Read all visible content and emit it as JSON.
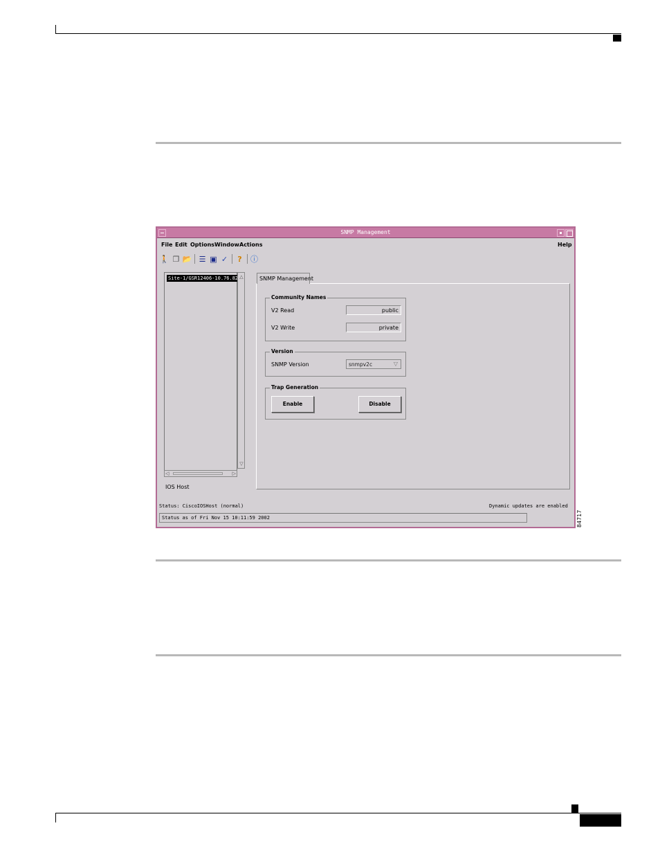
{
  "window": {
    "title": "SNMP Management"
  },
  "menubar": {
    "items": [
      "File",
      "Edit",
      "Options",
      "Window",
      "Actions"
    ],
    "help": "Help"
  },
  "toolbar": {
    "icons": [
      "walker-icon",
      "copy-icon",
      "folder-open-icon",
      "list-icon",
      "monitor-icon",
      "check-icon",
      "help-icon",
      "info-icon"
    ]
  },
  "tree": {
    "selected_item": "Site-1/GSR12406-10.76.82.",
    "panel_label": "IOS Host"
  },
  "tab": {
    "label": "SNMP Management"
  },
  "community": {
    "legend": "Community Names",
    "v2_read_label": "V2 Read",
    "v2_read_value": "public",
    "v2_write_label": "V2 Write",
    "v2_write_value": "private"
  },
  "version": {
    "legend": "Version",
    "label": "SNMP Version",
    "value": "snmpv2c"
  },
  "trap": {
    "legend": "Trap Generation",
    "enable_label": "Enable",
    "disable_label": "Disable"
  },
  "status": {
    "left": "Status: CiscoIOSHost (normal)",
    "right": "Dynamic updates are enabled",
    "bar": "Status as of Fri Nov 15 10:11:59 2002"
  },
  "figure_id": "84717",
  "colors": {
    "titlebar": "#c77aa4",
    "window_border": "#b36b94",
    "window_bg": "#d4d0d4"
  }
}
